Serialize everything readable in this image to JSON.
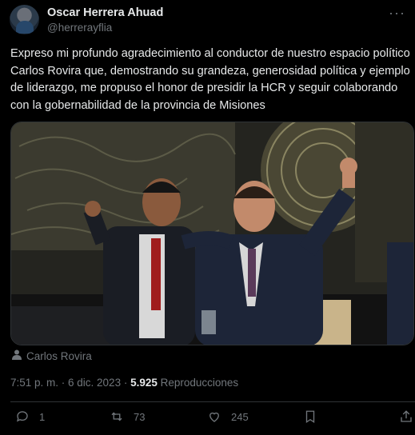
{
  "post": {
    "author_name": "Oscar Herrera Ahuad",
    "author_handle": "@herrerayflia",
    "text": "Expreso mi profundo agradecimiento al conductor de nuestro espacio político Carlos Rovira que, demostrando su grandeza, generosidad política y ejemplo de liderazgo, me propuso el honor de presidir la HCR y seguir colaborando con la gobernabilidad de la provincia de Misiones",
    "tagged_person": "Carlos Rovira",
    "timestamp": "7:51 p. m. · 6 dic. 2023 · ",
    "views_count": "5.925",
    "views_label": " Reproducciones"
  },
  "actions": {
    "replies": "1",
    "reposts": "73",
    "likes": "245"
  },
  "colors": {
    "background": "#000000",
    "text_primary": "#e7e9ea",
    "text_secondary": "#71767b",
    "divider": "#2f3336"
  },
  "icons": [
    "more-icon",
    "person-icon",
    "reply-icon",
    "repost-icon",
    "like-icon",
    "bookmark-icon",
    "share-icon"
  ]
}
